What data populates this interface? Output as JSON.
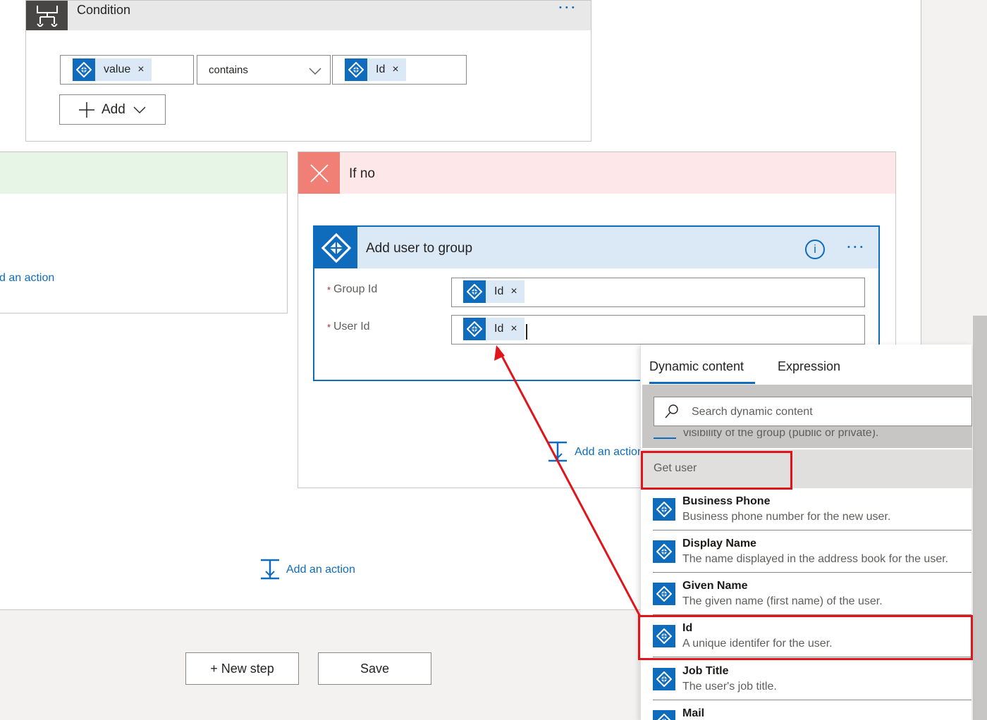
{
  "condition": {
    "title": "Condition",
    "more_label": "• • •",
    "left_token": "value",
    "operator": "contains",
    "right_token": "Id",
    "add_label": "Add",
    "remove_glyph": "×"
  },
  "if_no": {
    "title": "If no",
    "add_action_label": "Add an action"
  },
  "if_yes": {
    "add_action_label": "d an action"
  },
  "action_card": {
    "title": "Add user to group",
    "info_glyph": "i",
    "more_label": "• • •",
    "fields": [
      {
        "required_mark": "*",
        "label": "Group Id",
        "token": "Id"
      },
      {
        "required_mark": "*",
        "label": "User Id",
        "token": "Id"
      }
    ]
  },
  "outer_add_action_label": "Add an action",
  "footer": {
    "new_step_label": "+ New step",
    "save_label": "Save"
  },
  "dynamic_panel": {
    "tabs": [
      "Dynamic content",
      "Expression"
    ],
    "active_tab": "Dynamic content",
    "search_placeholder": "Search dynamic content",
    "clipped_text": "visibility of the group (public or private).",
    "section_header": "Get user",
    "items": [
      {
        "title": "Business Phone",
        "desc": "Business phone number for the new user."
      },
      {
        "title": "Display Name",
        "desc": "The name displayed in the address book for the user."
      },
      {
        "title": "Given Name",
        "desc": "The given name (first name) of the user."
      },
      {
        "title": "Id",
        "desc": "A unique identifer for the user."
      },
      {
        "title": "Job Title",
        "desc": "The user's job title."
      },
      {
        "title": "Mail",
        "desc": ""
      }
    ]
  },
  "colors": {
    "accent": "#0f6cbd",
    "condition_header": "#e8e8e8",
    "if_no_header": "#fde7e9",
    "if_no_icon": "#f08076",
    "if_yes_header": "#e6f5e6",
    "action_header": "#dbe9f7",
    "annotation_red": "#e0151b"
  },
  "icons": {
    "condition": "condition-icon",
    "aad": "azure-ad-icon",
    "close": "close-icon",
    "search": "search-icon",
    "info": "info-icon",
    "add_step": "add-step-icon",
    "chevron": "chevron-down-icon"
  }
}
